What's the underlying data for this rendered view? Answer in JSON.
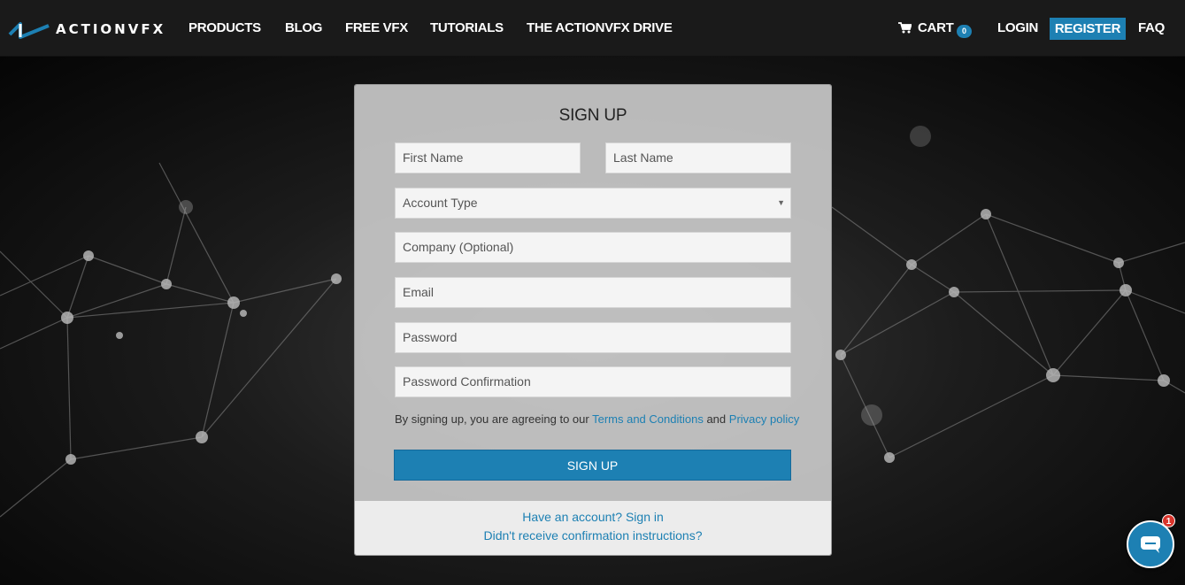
{
  "brand": {
    "name": "ACTIONVFX"
  },
  "nav": {
    "products": "PRODUCTS",
    "blog": "BLOG",
    "free_vfx": "FREE VFX",
    "tutorials": "TUTORIALS",
    "drive": "THE ACTIONVFX DRIVE",
    "cart": "CART",
    "cart_count": "0",
    "login": "LOGIN",
    "register": "REGISTER",
    "faq": "FAQ"
  },
  "form": {
    "title": "SIGN UP",
    "first_name_placeholder": "First Name",
    "last_name_placeholder": "Last Name",
    "account_type_label": "Account Type",
    "company_placeholder": "Company (Optional)",
    "email_placeholder": "Email",
    "password_placeholder": "Password",
    "password_confirm_placeholder": "Password Confirmation",
    "terms_prefix": "By signing up, you are agreeing to our",
    "terms_link": "Terms and Conditions",
    "terms_and": "and",
    "privacy_link": "Privacy policy",
    "submit_label": "SIGN UP",
    "sign_in_link": "Have an account? Sign in",
    "confirm_link": "Didn't receive confirmation instructions?"
  },
  "chat": {
    "badge_count": "1"
  },
  "colors": {
    "accent": "#1d80b3",
    "navbar": "#1a1a1a",
    "badge_red": "#d9342b"
  },
  "icons": [
    "cart-icon",
    "caret-down-icon",
    "chat-icon",
    "logo-icon"
  ]
}
